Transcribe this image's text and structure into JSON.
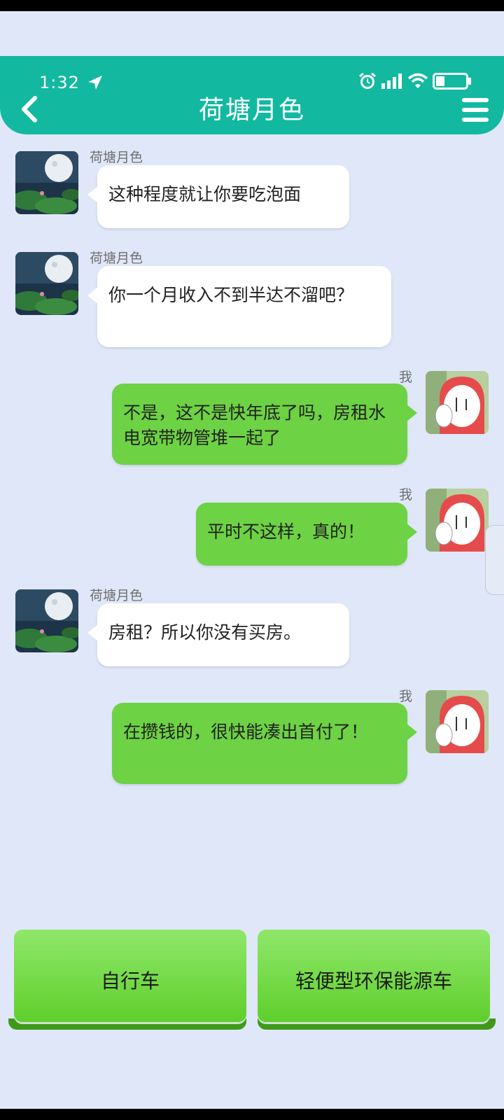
{
  "status_bar": {
    "time": "1:32"
  },
  "header": {
    "title": "荷塘月色"
  },
  "messages": [
    {
      "sender": "荷塘月色",
      "text": "这种程度就让你要吃泡面"
    },
    {
      "sender": "荷塘月色",
      "text": "你一个月收入不到半达不溜吧？"
    },
    {
      "sender": "我",
      "text": "不是，这不是快年底了吗，房租水电宽带物管堆一起了"
    },
    {
      "sender": "我",
      "text": "平时不这样，真的！"
    },
    {
      "sender": "荷塘月色",
      "text": "房租？所以你没有买房。"
    },
    {
      "sender": "我",
      "text": "在攒钱的，很快能凑出首付了！"
    }
  ],
  "choices": [
    {
      "label": "自行车"
    },
    {
      "label": "轻便型环保能源车"
    }
  ],
  "colors": {
    "header": "#12b9a0",
    "background": "#dfe7f8",
    "bubble_out": "#6dd244",
    "bubble_in": "#ffffff"
  },
  "icons": [
    "location-arrow-icon",
    "alarm-icon",
    "signal-icon",
    "wifi-icon",
    "battery-icon",
    "back-chevron-icon",
    "menu-icon"
  ]
}
